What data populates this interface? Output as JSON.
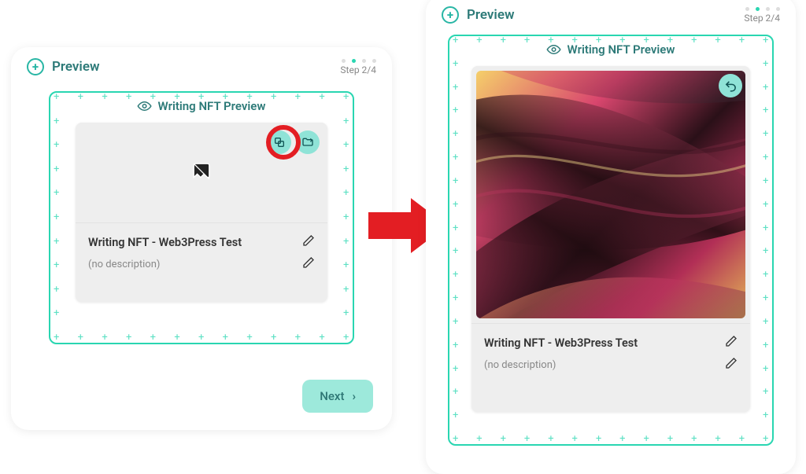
{
  "header": {
    "title": "Preview",
    "step_text": "Step 2/4",
    "active_dot": 1,
    "total_dots": 4
  },
  "preview": {
    "caption": "Writing NFT Preview",
    "card": {
      "title": "Writing NFT - Web3Press Test",
      "description": "(no description)"
    }
  },
  "actions": {
    "next_label": "Next"
  },
  "icons": {
    "plus": "plus-circle-icon",
    "eye": "eye-icon",
    "image_broken": "broken-image-icon",
    "regenerate": "regenerate-icon",
    "upload": "upload-folder-icon",
    "undo": "undo-icon",
    "pencil": "pencil-icon",
    "chevron_right": "chevron-right-icon",
    "arrow": "big-red-arrow-icon"
  },
  "colors": {
    "accent": "#29d6b1",
    "accent_dark": "#2d7a78",
    "btn_bg": "#9de9db",
    "highlight": "#e31e23"
  }
}
